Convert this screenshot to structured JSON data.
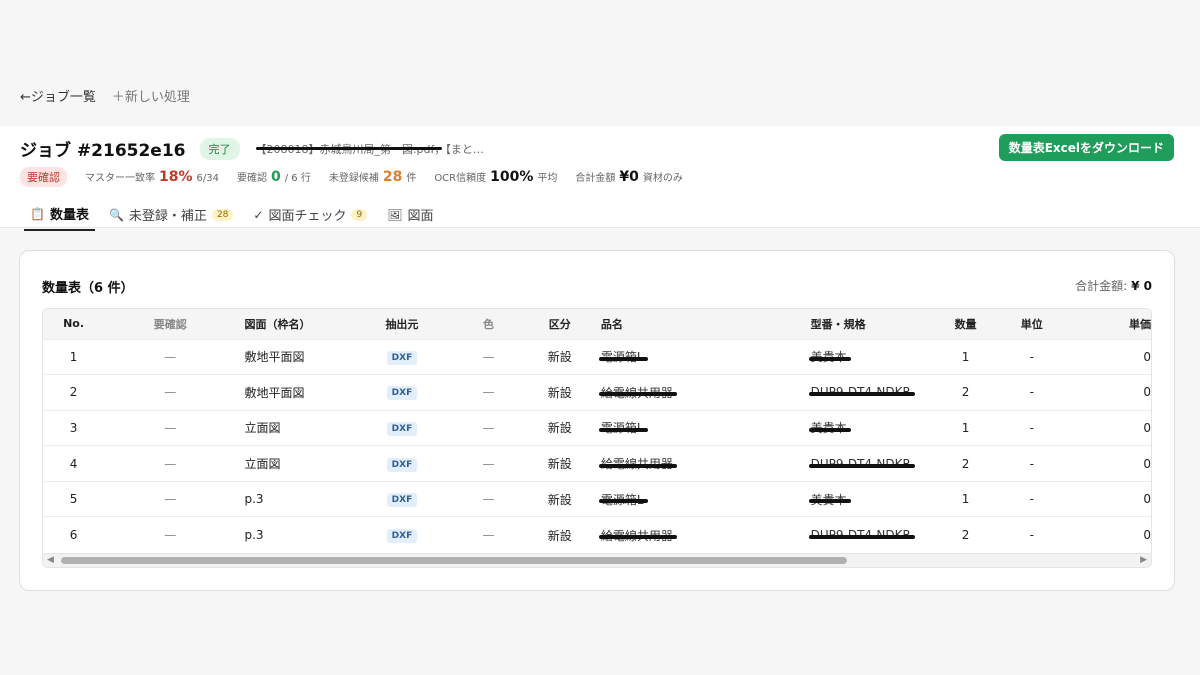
{
  "nav": {
    "back_label": "←ジョブ一覧",
    "new_label": "＋新しい処理"
  },
  "job": {
    "title": "ジョブ #21652e16",
    "status": "完了",
    "file_name": "【208018】赤城鳥川局_第一図.pdf，【まと…",
    "download_label": "数量表Excelをダウンロード"
  },
  "stats": {
    "needs_badge": "要確認",
    "master_label": "マスター一致率",
    "master_value": "18%",
    "master_sub": "6/34",
    "confirm_label": "要確認",
    "confirm_value": "0",
    "confirm_sub": "/ 6 行",
    "unreg_label": "未登録候補",
    "unreg_value": "28",
    "unreg_sub": "件",
    "ocr_label": "OCR信頼度",
    "ocr_value": "100%",
    "ocr_sub": "平均",
    "total_label": "合計金額",
    "total_value": "¥0",
    "total_sub": "資材のみ"
  },
  "tabs": [
    {
      "icon": "📋",
      "label": "数量表",
      "count": ""
    },
    {
      "icon": "🔍",
      "label": "未登録・補正",
      "count": "28"
    },
    {
      "icon": "✓",
      "label": "図面チェック",
      "count": "9"
    },
    {
      "icon": "🖼",
      "label": "図面",
      "count": ""
    }
  ],
  "card": {
    "title": "数量表（6 件）",
    "total_label": "合計金額:",
    "total_value": "¥ 0"
  },
  "table": {
    "headers": [
      "No.",
      "要確認",
      "図面（枠名）",
      "抽出元",
      "色",
      "区分",
      "品名",
      "型番・規格",
      "数量",
      "単位",
      "単価"
    ],
    "rows": [
      {
        "no": "1",
        "check": "—",
        "figure": "敷地平面図",
        "source": "DXF",
        "color": "—",
        "kubun": "新設",
        "name": "電源箱L",
        "model": "美貴本",
        "qty": "1",
        "unit": "-",
        "price": "0"
      },
      {
        "no": "2",
        "check": "—",
        "figure": "敷地平面図",
        "source": "DXF",
        "color": "—",
        "kubun": "新設",
        "name": "給電線共用器",
        "model": "DUP9-DT4-NDKR",
        "qty": "2",
        "unit": "-",
        "price": "0"
      },
      {
        "no": "3",
        "check": "—",
        "figure": "立面図",
        "source": "DXF",
        "color": "—",
        "kubun": "新設",
        "name": "電源箱L",
        "model": "美貴本",
        "qty": "1",
        "unit": "-",
        "price": "0"
      },
      {
        "no": "4",
        "check": "—",
        "figure": "立面図",
        "source": "DXF",
        "color": "—",
        "kubun": "新設",
        "name": "給電線共用器",
        "model": "DUP9-DT4-NDKR",
        "qty": "2",
        "unit": "-",
        "price": "0"
      },
      {
        "no": "5",
        "check": "—",
        "figure": "p.3",
        "source": "DXF",
        "color": "—",
        "kubun": "新設",
        "name": "電源箱L",
        "model": "美貴本",
        "qty": "1",
        "unit": "-",
        "price": "0"
      },
      {
        "no": "6",
        "check": "—",
        "figure": "p.3",
        "source": "DXF",
        "color": "—",
        "kubun": "新設",
        "name": "給電線共用器",
        "model": "DUP9-DT4-NDKR",
        "qty": "2",
        "unit": "-",
        "price": "0"
      }
    ]
  }
}
